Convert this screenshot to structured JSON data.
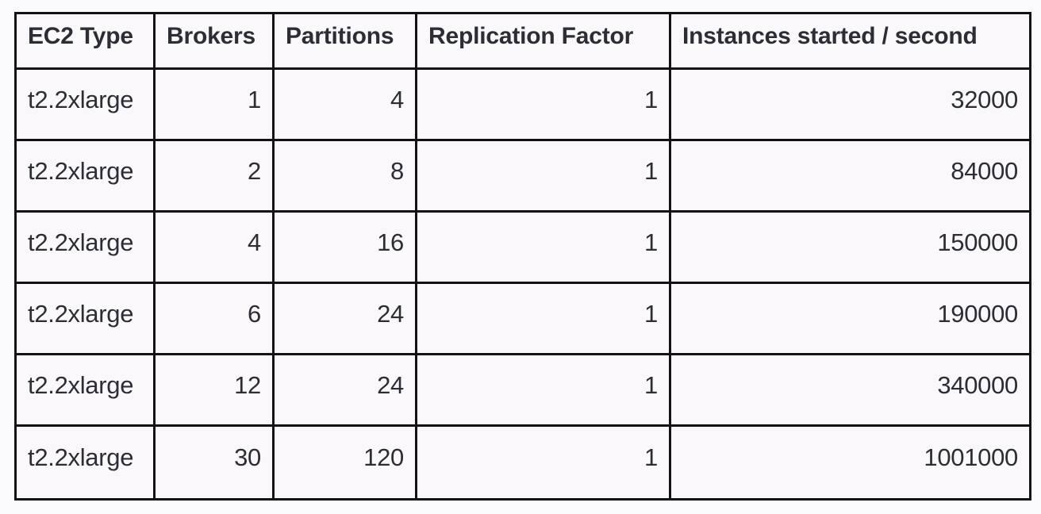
{
  "table": {
    "columns": [
      {
        "key": "ec2_type",
        "label": "EC2 Type",
        "align": "left"
      },
      {
        "key": "brokers",
        "label": "Brokers",
        "align": "right"
      },
      {
        "key": "partitions",
        "label": "Partitions",
        "align": "right"
      },
      {
        "key": "replication",
        "label": "Replication Factor",
        "align": "right"
      },
      {
        "key": "instances",
        "label": "Instances started / second",
        "align": "right"
      }
    ],
    "rows": [
      {
        "ec2_type": "t2.2xlarge",
        "brokers": "1",
        "partitions": "4",
        "replication": "1",
        "instances": "32000"
      },
      {
        "ec2_type": "t2.2xlarge",
        "brokers": "2",
        "partitions": "8",
        "replication": "1",
        "instances": "84000"
      },
      {
        "ec2_type": "t2.2xlarge",
        "brokers": "4",
        "partitions": "16",
        "replication": "1",
        "instances": "150000"
      },
      {
        "ec2_type": "t2.2xlarge",
        "brokers": "6",
        "partitions": "24",
        "replication": "1",
        "instances": "190000"
      },
      {
        "ec2_type": "t2.2xlarge",
        "brokers": "12",
        "partitions": "24",
        "replication": "1",
        "instances": "340000"
      },
      {
        "ec2_type": "t2.2xlarge",
        "brokers": "30",
        "partitions": "120",
        "replication": "1",
        "instances": "1001000"
      }
    ]
  },
  "chart_data": {
    "type": "table",
    "title": "",
    "columns": [
      "EC2 Type",
      "Brokers",
      "Partitions",
      "Replication Factor",
      "Instances started / second"
    ],
    "rows": [
      [
        "t2.2xlarge",
        1,
        4,
        1,
        32000
      ],
      [
        "t2.2xlarge",
        2,
        8,
        1,
        84000
      ],
      [
        "t2.2xlarge",
        4,
        16,
        1,
        150000
      ],
      [
        "t2.2xlarge",
        6,
        24,
        1,
        190000
      ],
      [
        "t2.2xlarge",
        12,
        24,
        1,
        340000
      ],
      [
        "t2.2xlarge",
        30,
        120,
        1,
        1001000
      ]
    ],
    "xlabel": "Brokers",
    "ylabel": "Instances started / second",
    "grid": true
  },
  "style": {
    "border_color": "#141218",
    "text_color": "#2d2d35",
    "cell_background": "#faf8fb",
    "page_background": "#fbfafc"
  }
}
